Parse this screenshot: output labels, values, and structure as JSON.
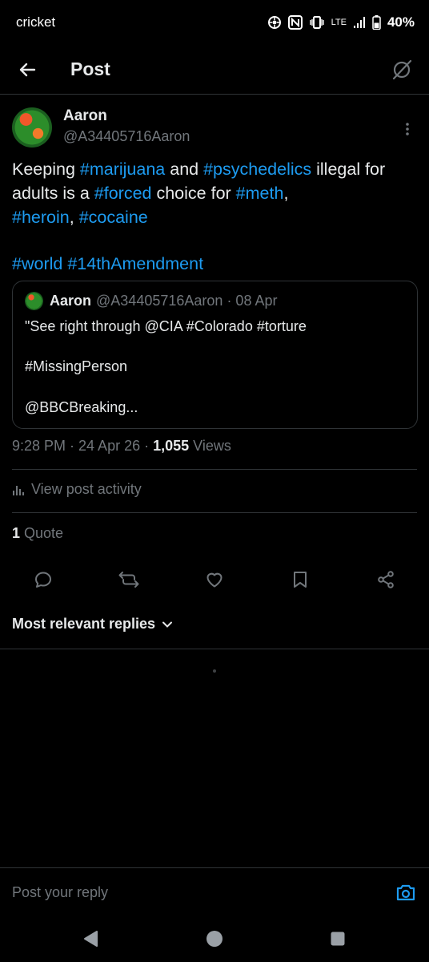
{
  "status_bar": {
    "carrier": "cricket",
    "network": "LTE",
    "battery": "40%"
  },
  "app_bar": {
    "title": "Post"
  },
  "post": {
    "author_name": "Aaron",
    "author_handle": "@A34405716Aaron",
    "text": {
      "w1": "Keeping ",
      "t1": "#marijuana",
      "w2": " and ",
      "t2": "#psychedelics",
      "w3": " illegal for adults is a ",
      "t3": "#forced",
      "w4": " choice for ",
      "t4": "#meth",
      "w5": ", ",
      "t5": "#heroin",
      "w6": ", ",
      "t6": "#cocaine",
      "t7": "#world",
      "w7": " ",
      "t8": "#14thAmendment"
    },
    "quoted": {
      "author_name": "Aaron",
      "author_handle": "@A34405716Aaron",
      "date": "· 08 Apr",
      "line1": "\"See right through @CIA #Colorado    #torture",
      "line2": "#MissingPerson",
      "line3": "@BBCBreaking..."
    },
    "time": "9:28 PM · 24 Apr 26 · ",
    "views_count": "1,055",
    "views_label": " Views",
    "activity_label": "View post activity",
    "quote_count": "1",
    "quote_label": " Quote"
  },
  "replies": {
    "sort_label": "Most relevant replies"
  },
  "reply_bar": {
    "placeholder": "Post your reply"
  },
  "colors": {
    "background": "#000000",
    "accent": "#1d9bf0",
    "text": "#e7e9ea",
    "muted": "#71767b",
    "divider": "#2f3336"
  }
}
